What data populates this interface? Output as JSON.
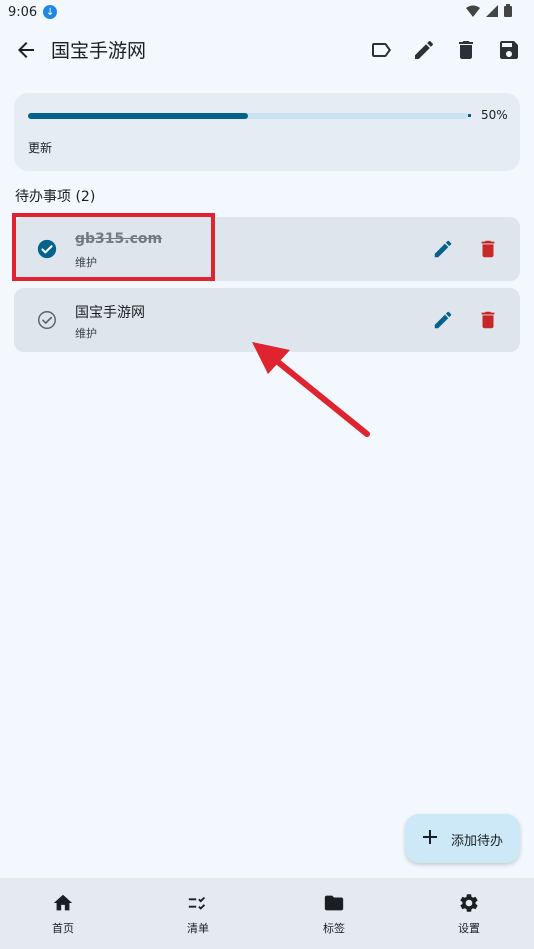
{
  "status_bar": {
    "time": "9:06"
  },
  "app_bar": {
    "title": "国宝手游网",
    "back_icon": "arrow-back-icon",
    "actions": [
      "label-icon",
      "edit-icon",
      "delete-icon",
      "save-icon"
    ]
  },
  "progress": {
    "percent": 0.5,
    "percent_text": "50%",
    "label": "更新"
  },
  "todos": {
    "header": "待办事项 (2)",
    "items": [
      {
        "title": "gb315.com",
        "subtitle": "维护",
        "completed": true
      },
      {
        "title": "国宝手游网",
        "subtitle": "维护",
        "completed": false
      }
    ]
  },
  "fab": {
    "label": "添加待办"
  },
  "bottom_nav": {
    "items": [
      {
        "label": "首页",
        "icon": "home-icon"
      },
      {
        "label": "清单",
        "icon": "checklist-icon"
      },
      {
        "label": "标签",
        "icon": "folder-icon"
      },
      {
        "label": "设置",
        "icon": "gear-icon"
      }
    ]
  },
  "colors": {
    "accent": "#05638b",
    "danger": "#c62828",
    "highlight": "#e0242f",
    "background": "#f2f8fd"
  }
}
